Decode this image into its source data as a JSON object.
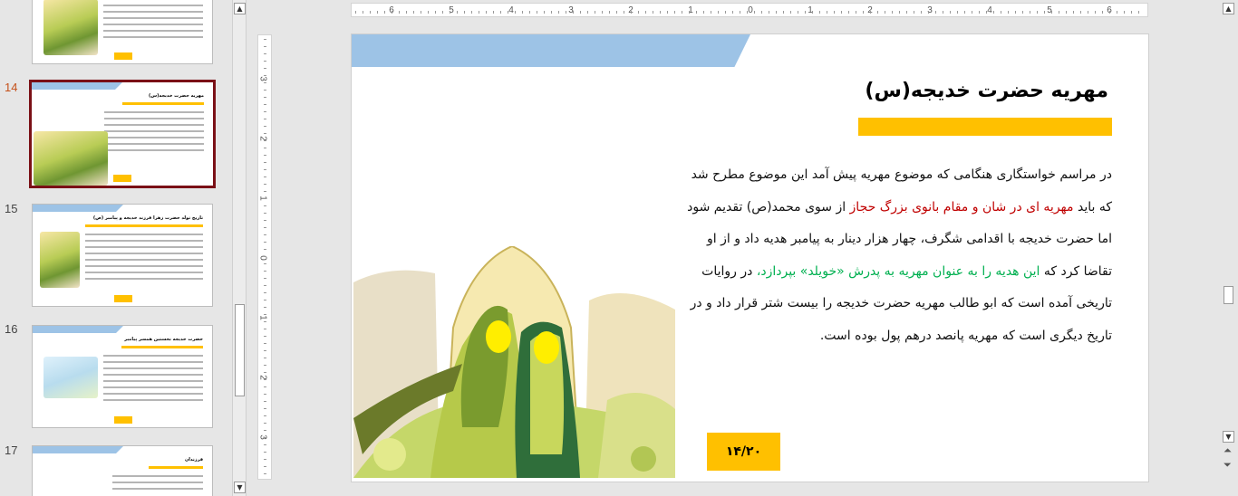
{
  "thumbnails": [
    {
      "number": "",
      "title": "",
      "active": false
    },
    {
      "number": "14",
      "title": "مهریه حضرت خدیجه(س)",
      "active": true
    },
    {
      "number": "15",
      "title": "تاریخ تولد حضرت زهرا فرزند خدیجه و پیامبر (ص)",
      "active": false
    },
    {
      "number": "16",
      "title": "حضرت خدیجه نخستین همسر پیامبر",
      "active": false
    },
    {
      "number": "17",
      "title": "فرزندان",
      "active": false
    }
  ],
  "ruler": {
    "horizontal": [
      "6",
      "5",
      "4",
      "3",
      "2",
      "1",
      "0",
      "1",
      "2",
      "3",
      "4",
      "5",
      "6"
    ],
    "vertical": [
      "3",
      "2",
      "1",
      "0",
      "1",
      "2",
      "3"
    ]
  },
  "slide": {
    "title": "مهریه حضرت خدیجه(س)",
    "body": {
      "p1": "در مراسم خواستگاری هنگامی که موضوع مهریه پیش آمد این موضوع مطرح شد که باید ",
      "red": "مهریه ای در شان و مقام بانوی بزرگ حجاز",
      "p2": " از سوی محمد(ص) تقدیم شود اما حضرت خدیجه با اقدامی شگرف، چهار هزار دینار به پیامبر هدیه داد و از او تقاضا کرد که ",
      "green": "این هدیه را به عنوان مهریه به پدرش «خویلد» بپردازد،",
      "p3": " در روایات تاریخی آمده است که ابو طالب مهریه حضرت خدیجه را بیست شتر قرار داد و در تاریخ دیگری است که مهریه پانصد درهم پول بوده است."
    },
    "page_box": "۱۴/۲۰"
  },
  "colors": {
    "accent_blue": "#9dc3e6",
    "accent_yellow": "#ffc000",
    "highlight_red": "#c00000",
    "highlight_green": "#00b050",
    "active_thumb_border": "#7a1016",
    "active_number": "#c5511a"
  },
  "icons": {
    "scroll_up": "triangle-up-icon",
    "scroll_down": "triangle-down-icon",
    "prev_slide": "double-chevron-up-icon",
    "next_slide": "double-chevron-down-icon"
  }
}
